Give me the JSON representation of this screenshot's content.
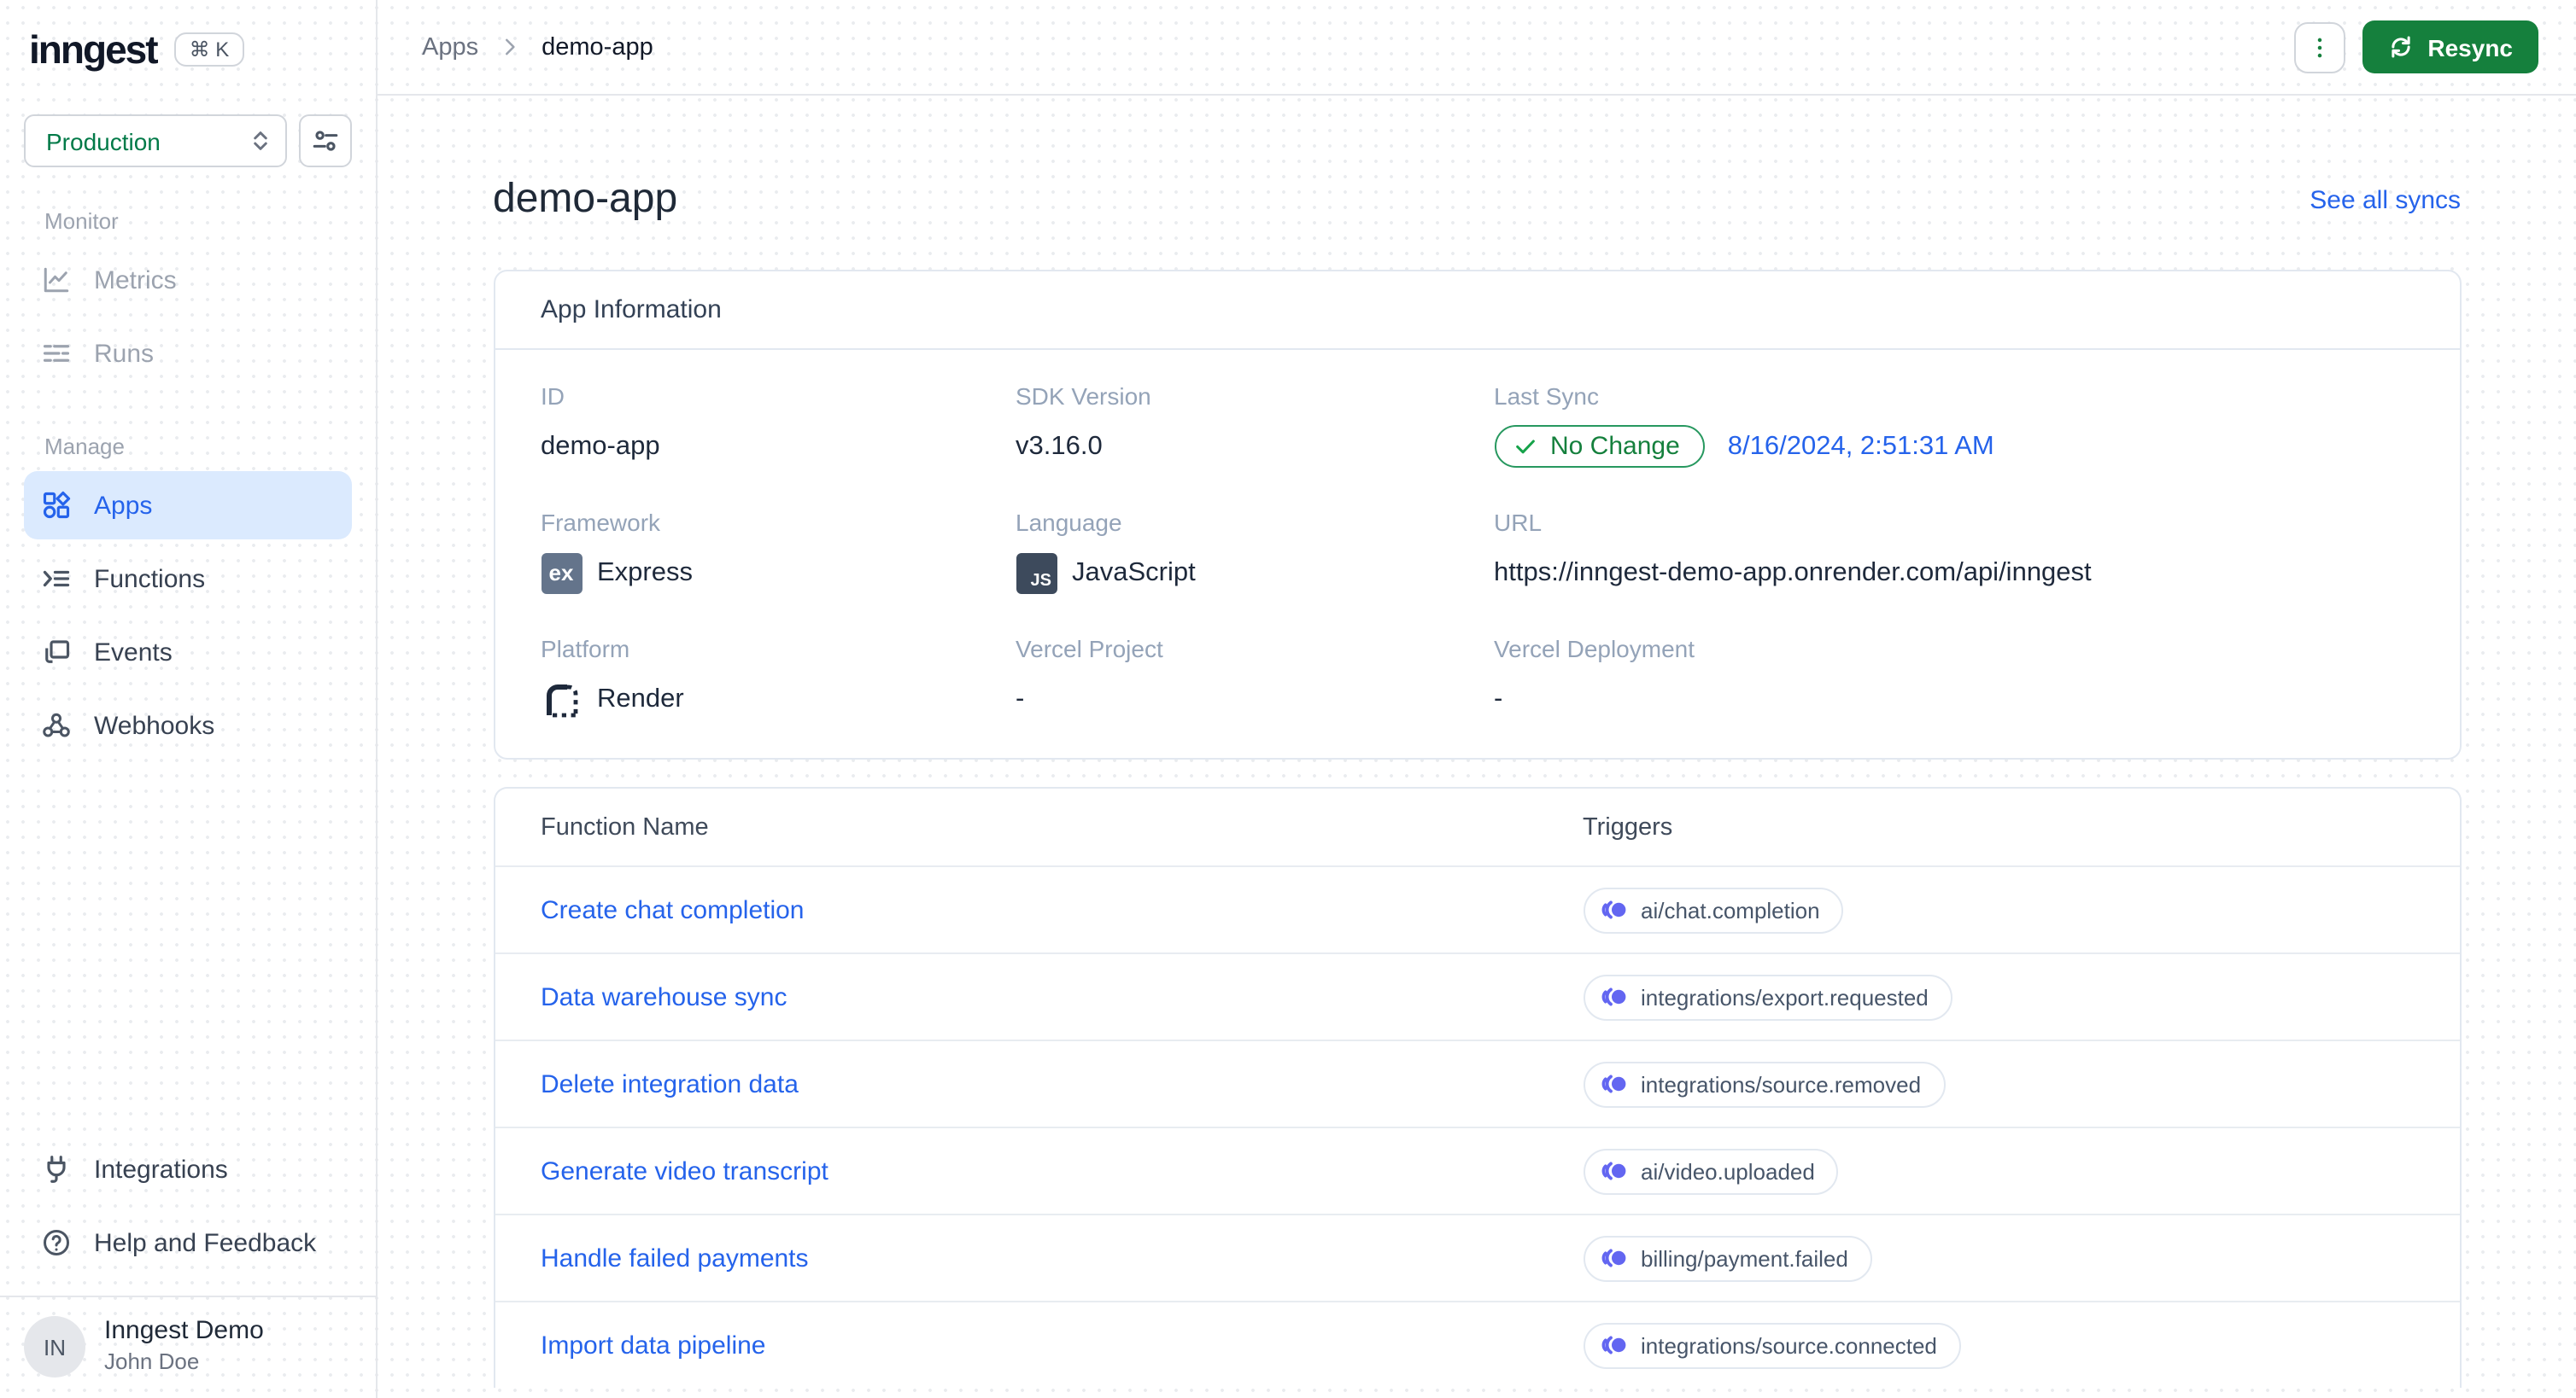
{
  "sidebar": {
    "logo": "inngest",
    "command_palette_shortcut": "⌘ K",
    "env_selector": {
      "value": "Production"
    },
    "sections": [
      {
        "label": "Monitor",
        "items": [
          {
            "label": "Metrics"
          },
          {
            "label": "Runs"
          }
        ]
      },
      {
        "label": "Manage",
        "items": [
          {
            "label": "Apps"
          },
          {
            "label": "Functions"
          },
          {
            "label": "Events"
          },
          {
            "label": "Webhooks"
          }
        ]
      }
    ],
    "footer_items": [
      {
        "label": "Integrations"
      },
      {
        "label": "Help and Feedback"
      }
    ],
    "user": {
      "initials": "IN",
      "org": "Inngest Demo",
      "name": "John Doe"
    }
  },
  "topbar": {
    "breadcrumb": [
      {
        "label": "Apps"
      },
      {
        "label": "demo-app"
      }
    ],
    "resync_label": "Resync"
  },
  "page": {
    "title": "demo-app",
    "see_all_syncs": "See all syncs"
  },
  "app_info": {
    "card_title": "App Information",
    "icon_texts": {
      "express": "ex",
      "javascript": "JS"
    },
    "fields": [
      {
        "label": "ID",
        "value": "demo-app"
      },
      {
        "label": "SDK Version",
        "value": "v3.16.0"
      },
      {
        "label": "Last Sync",
        "badge": "No Change",
        "timestamp": "8/16/2024, 2:51:31 AM"
      },
      {
        "label": "Framework",
        "value": "Express"
      },
      {
        "label": "Language",
        "value": "JavaScript"
      },
      {
        "label": "URL",
        "value": "https://inngest-demo-app.onrender.com/api/inngest"
      },
      {
        "label": "Platform",
        "value": "Render"
      },
      {
        "label": "Vercel Project",
        "value": "-"
      },
      {
        "label": "Vercel Deployment",
        "value": "-"
      }
    ]
  },
  "functions_table": {
    "columns": [
      "Function Name",
      "Triggers"
    ],
    "rows": [
      {
        "name": "Create chat completion",
        "trigger": "ai/chat.completion"
      },
      {
        "name": "Data warehouse sync",
        "trigger": "integrations/export.requested"
      },
      {
        "name": "Delete integration data",
        "trigger": "integrations/source.removed"
      },
      {
        "name": "Generate video transcript",
        "trigger": "ai/video.uploaded"
      },
      {
        "name": "Handle failed payments",
        "trigger": "billing/payment.failed"
      },
      {
        "name": "Import data pipeline",
        "trigger": "integrations/source.connected"
      }
    ]
  },
  "colors": {
    "accent_green": "#15803d",
    "link_blue": "#2563eb",
    "trigger_icon_blue": "#6366f1",
    "active_nav_bg": "#dbeafe"
  }
}
